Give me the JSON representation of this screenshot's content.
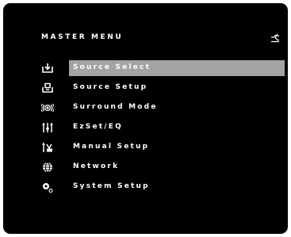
{
  "header": {
    "title": "MASTER MENU",
    "corner_icon": "mute-speaker-icon"
  },
  "menu": {
    "selected_index": 0,
    "highlight_color": "#a3a3a3",
    "items": [
      {
        "label": "Source Select",
        "icon": "source-select-icon"
      },
      {
        "label": "Source Setup",
        "icon": "source-setup-icon"
      },
      {
        "label": "Surround Mode",
        "icon": "surround-mode-icon"
      },
      {
        "label": "EzSet/EQ",
        "icon": "ezset-eq-icon"
      },
      {
        "label": "Manual Setup",
        "icon": "manual-setup-icon"
      },
      {
        "label": "Network",
        "icon": "network-globe-icon"
      },
      {
        "label": "System Setup",
        "icon": "system-setup-icon"
      }
    ]
  }
}
